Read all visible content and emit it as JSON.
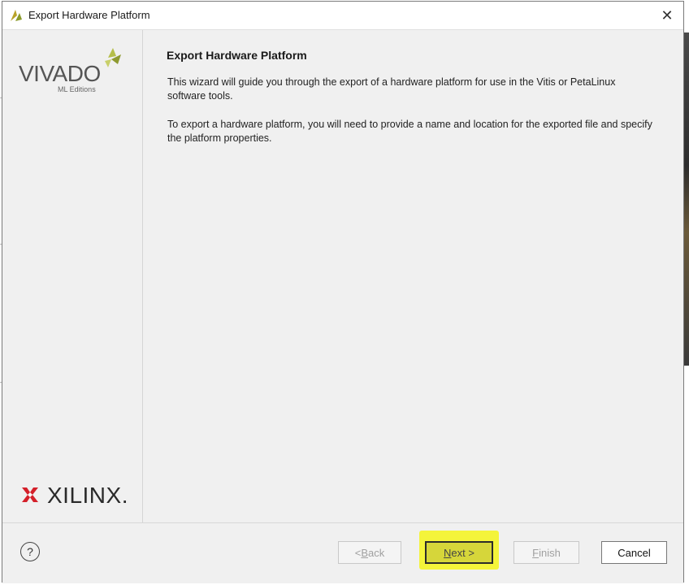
{
  "window": {
    "title": "Export Hardware Platform",
    "close_glyph": "✕"
  },
  "sidebar": {
    "vivado_word": "VIVADO",
    "vivado_sub": "ML Editions",
    "xilinx_word": "XILINX."
  },
  "main": {
    "title": "Export Hardware Platform",
    "paragraph1": "This wizard will guide you through the export of a hardware platform for use in the Vitis or PetaLinux software tools.",
    "paragraph2": "To export a hardware platform, you will need to provide a name and location for the exported file and specify the platform properties."
  },
  "footer": {
    "help_glyph": "?",
    "back_prefix": "< ",
    "back_key": "B",
    "back_rest": "ack",
    "next_key": "N",
    "next_rest": "ext >",
    "finish_key": "F",
    "finish_rest": "inish",
    "cancel_label": "Cancel"
  },
  "colors": {
    "highlight": "#f4f43a",
    "vivado_leaf": "#9aa53c",
    "xilinx_red": "#d4202a"
  }
}
